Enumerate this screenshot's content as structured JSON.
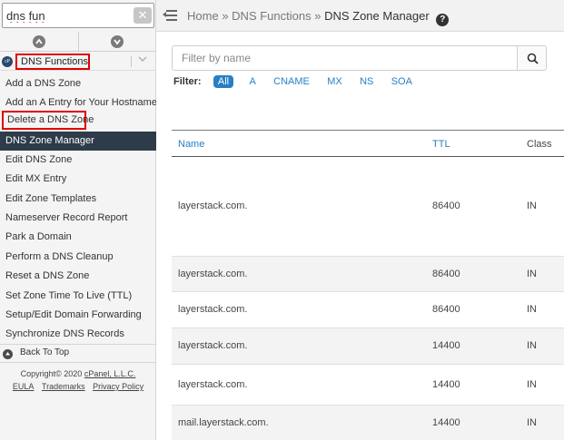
{
  "sidebar": {
    "search_value": "dns fun",
    "clear_label": "✕",
    "group_label": "DNS Functions",
    "group_logo_text": "cP",
    "items": [
      {
        "label": "Add a DNS Zone"
      },
      {
        "label": "Add an A Entry for Your Hostname"
      },
      {
        "label": "Delete a DNS Zone"
      },
      {
        "label": "DNS Zone Manager"
      },
      {
        "label": "Edit DNS Zone"
      },
      {
        "label": "Edit MX Entry"
      },
      {
        "label": "Edit Zone Templates"
      },
      {
        "label": "Nameserver Record Report"
      },
      {
        "label": "Park a Domain"
      },
      {
        "label": "Perform a DNS Cleanup"
      },
      {
        "label": "Reset a DNS Zone"
      },
      {
        "label": "Set Zone Time To Live (TTL)"
      },
      {
        "label": "Setup/Edit Domain Forwarding"
      },
      {
        "label": "Synchronize DNS Records"
      }
    ],
    "back_to_top": "Back To Top",
    "copyright_prefix": "Copyright© 2020",
    "copyright_company": "cPanel, L.L.C.",
    "footer_links": [
      "EULA",
      "Trademarks",
      "Privacy Policy"
    ]
  },
  "topbar": {
    "crumb_home": "Home",
    "separator": "»",
    "crumb_section": "DNS Functions",
    "crumb_current": "DNS Zone Manager",
    "help": "?"
  },
  "main": {
    "filter_placeholder": "Filter by name",
    "filter_label": "Filter:",
    "filter_types": [
      "All",
      "A",
      "CNAME",
      "MX",
      "NS",
      "SOA"
    ],
    "columns": [
      "Name",
      "TTL",
      "Class"
    ],
    "rows": [
      {
        "name": "layerstack.com.",
        "ttl": "86400",
        "class": "IN"
      },
      {
        "name": "layerstack.com.",
        "ttl": "86400",
        "class": "IN"
      },
      {
        "name": "layerstack.com.",
        "ttl": "86400",
        "class": "IN"
      },
      {
        "name": "layerstack.com.",
        "ttl": "14400",
        "class": "IN"
      },
      {
        "name": "layerstack.com.",
        "ttl": "14400",
        "class": "IN"
      },
      {
        "name": "mail.layerstack.com.",
        "ttl": "14400",
        "class": "IN"
      }
    ]
  },
  "colors": {
    "accent": "#2a7fc2",
    "active_nav": "#2e3b49",
    "highlight_box": "#e00000"
  }
}
